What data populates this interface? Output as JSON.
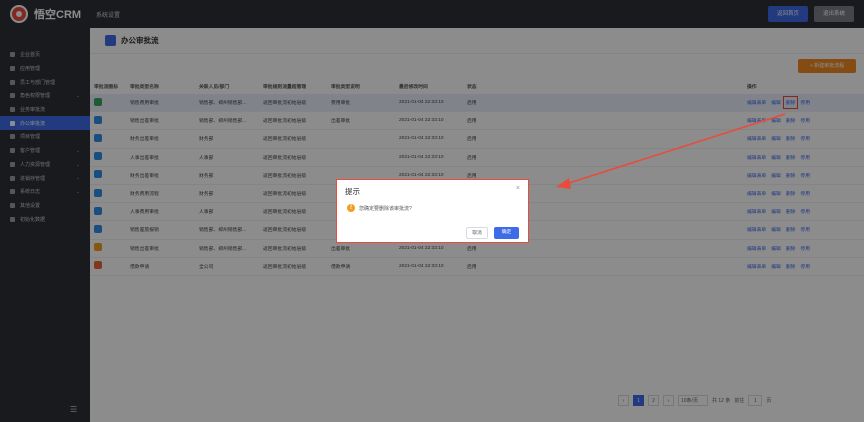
{
  "app": {
    "logo_text": "悟空CRM",
    "section": "系统设置"
  },
  "top_actions": {
    "home": "返回首页",
    "exit": "退出系统"
  },
  "sidebar": {
    "items": [
      {
        "label": "企业首页",
        "chevron": ""
      },
      {
        "label": "应用管理",
        "chevron": ""
      },
      {
        "label": "员工与部门管理",
        "chevron": ""
      },
      {
        "label": "角色权限管理",
        "chevron": "⌄"
      },
      {
        "label": "业务审批流",
        "chevron": ""
      },
      {
        "label": "办公审批流",
        "chevron": ""
      },
      {
        "label": "项目管理",
        "chevron": ""
      },
      {
        "label": "客户管理",
        "chevron": "⌄"
      },
      {
        "label": "人力资源管理",
        "chevron": "⌄"
      },
      {
        "label": "进销存管理",
        "chevron": "⌄"
      },
      {
        "label": "系统日志",
        "chevron": "⌄"
      },
      {
        "label": "其他设置",
        "chevron": ""
      },
      {
        "label": "初始化数据",
        "chevron": ""
      }
    ],
    "active_index": 5,
    "toggle": "☰"
  },
  "page": {
    "title": "办公审批流",
    "add_button": "+ 新建审批流程"
  },
  "table": {
    "headers": [
      "审批流图标",
      "审批类型名称",
      "关联人员/部门",
      "审批规则流量超管理",
      "审批类型说明",
      "最后修改时间",
      "状态",
      "",
      "操作"
    ],
    "rows": [
      {
        "icon_color": "#3aa55c",
        "name": "销售费用审批",
        "dept": "销售部、郑州销售部...",
        "rule": "返回审批流初始层级",
        "desc": "费用审批",
        "time": "2021-01-04 22:33:10",
        "status": "启用"
      },
      {
        "icon_color": "#2f8ee6",
        "name": "销售出差审批",
        "dept": "销售部、郑州销售部...",
        "rule": "返回审批流初始层级",
        "desc": "出差审批",
        "time": "2021-01-04 22:33:10",
        "status": "启用"
      },
      {
        "icon_color": "#2f8ee6",
        "name": "财务出差审批",
        "dept": "财务部",
        "rule": "返回审批流初始层级",
        "desc": "",
        "time": "2021-01-04 22:33:10",
        "status": "启用"
      },
      {
        "icon_color": "#2f8ee6",
        "name": "人事出差审批",
        "dept": "人事部",
        "rule": "返回审批流初始层级",
        "desc": "",
        "time": "2021-01-04 22:33:10",
        "status": "启用"
      },
      {
        "icon_color": "#2f8ee6",
        "name": "财务出差审批",
        "dept": "财务部",
        "rule": "返回审批流初始层级",
        "desc": "",
        "time": "2021-01-04 22:33:10",
        "status": "启用"
      },
      {
        "icon_color": "#2f8ee6",
        "name": "财务费用流程",
        "dept": "财务部",
        "rule": "返回审批流初始层级",
        "desc": "",
        "time": "",
        "status": ""
      },
      {
        "icon_color": "#2f8ee6",
        "name": "人事费用审批",
        "dept": "人事部",
        "rule": "返回审批流初始层级",
        "desc": "",
        "time": "",
        "status": ""
      },
      {
        "icon_color": "#2f8ee6",
        "name": "销售差旅报销",
        "dept": "销售部、郑州销售部...",
        "rule": "返回审批流初始层级",
        "desc": "",
        "time": "",
        "status": ""
      },
      {
        "icon_color": "#f0a020",
        "name": "销售出差审批",
        "dept": "销售部、郑州销售部...",
        "rule": "返回审批流初始层级",
        "desc": "出差审批",
        "time": "2021-01-04 22:33:10",
        "status": "启用"
      },
      {
        "icon_color": "#e8653a",
        "name": "借款申请",
        "dept": "全公司",
        "rule": "返回审批流初始层级",
        "desc": "借款申请",
        "time": "2021-01-04 22:33:10",
        "status": "启用"
      }
    ],
    "ops": [
      "编辑表单",
      "编辑",
      "删除",
      "停用"
    ]
  },
  "pager": {
    "prev": "‹",
    "page1": "1",
    "page2": "2",
    "next": "›",
    "per_page": "10条/页",
    "total": "共 12 条",
    "goto": "前往",
    "goto_value": "1",
    "page_unit": "页"
  },
  "dialog": {
    "title": "提示",
    "close": "×",
    "warn_icon": "!",
    "message": "您确定要删除该审批流?",
    "cancel": "取消",
    "confirm": "确定"
  },
  "colors": {
    "accent": "#3e6bea",
    "highlight": "#e84c3d",
    "add": "#f08a24"
  }
}
